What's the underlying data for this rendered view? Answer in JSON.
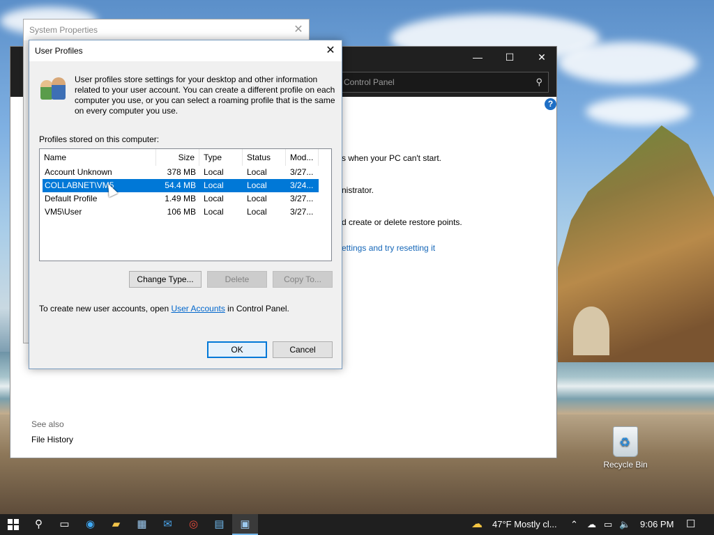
{
  "control_panel": {
    "search_placeholder": "Control Panel",
    "lines": [
      "s when your PC can't start.",
      "nistrator.",
      "d create or delete restore points."
    ],
    "link": "ettings and try resetting it",
    "see_also": "See also",
    "file_history": "File History",
    "help_glyph": "?",
    "controls": {
      "minimize": "—",
      "maximize": "☐",
      "close": "✕"
    }
  },
  "system_properties": {
    "title": "System Properties",
    "close_glyph": "✕"
  },
  "dialog": {
    "title": "User Profiles",
    "close_glyph": "✕",
    "intro": "User profiles store settings for your desktop and other information related to your user account. You can create a different profile on each computer you use, or you can select a roaming profile that is the same on every computer you use.",
    "profiles_label": "Profiles stored on this computer:",
    "columns": [
      "Name",
      "Size",
      "Type",
      "Status",
      "Mod..."
    ],
    "rows": [
      {
        "name": "Account Unknown",
        "size": "378 MB",
        "type": "Local",
        "status": "Local",
        "modified": "3/27..."
      },
      {
        "name": "COLLABNET\\VM5",
        "size": "54.4 MB",
        "type": "Local",
        "status": "Local",
        "modified": "3/24..."
      },
      {
        "name": "Default Profile",
        "size": "1.49 MB",
        "type": "Local",
        "status": "Local",
        "modified": "3/27..."
      },
      {
        "name": "VM5\\User",
        "size": "106 MB",
        "type": "Local",
        "status": "Local",
        "modified": "3/27..."
      }
    ],
    "selected_row": 1,
    "buttons": {
      "change_type": "Change Type...",
      "delete": "Delete",
      "copy_to": "Copy To...",
      "ok": "OK",
      "cancel": "Cancel"
    },
    "create_note": {
      "before": "To create new user accounts, open ",
      "link": "User Accounts",
      "after": " in Control Panel."
    }
  },
  "desktop": {
    "recycle_bin": "Recycle Bin"
  },
  "taskbar": {
    "weather": "47°F  Mostly cl...",
    "time": "9:06 PM",
    "icons": [
      "windows-start-icon",
      "search-icon",
      "task-view-icon",
      "edge-icon",
      "file-explorer-icon",
      "store-icon",
      "mail-icon",
      "chrome-icon",
      "control-panel-icon",
      "system-properties-icon"
    ]
  },
  "colors": {
    "selection": "#0078d7",
    "link": "#0066cc",
    "titlebar_dark": "#202020",
    "taskbar": "#1f1f1f"
  }
}
